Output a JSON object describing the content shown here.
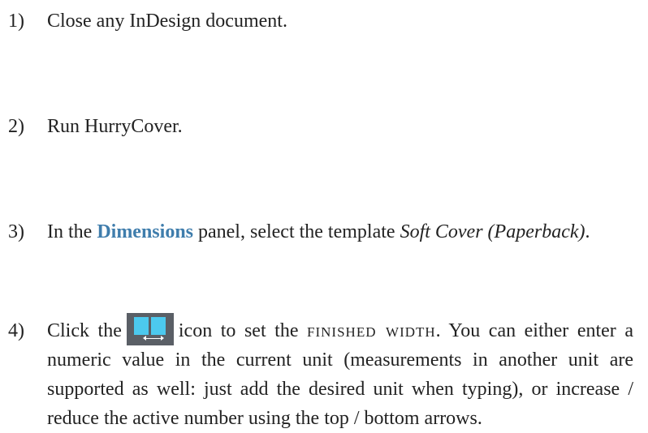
{
  "steps": [
    {
      "number": "1)",
      "text": "Close any InDesign document."
    },
    {
      "number": "2)",
      "text": "Run HurryCover."
    },
    {
      "number": "3)",
      "text_before": "In the ",
      "panel_name": "Dimensions",
      "text_middle": " panel, select the template ",
      "template_name": "Soft Cover (Paperback)",
      "text_end": "."
    },
    {
      "number": "4)",
      "text_before": "Click the",
      "icon": "finished-width-icon",
      "text_after_icon": "icon to set the ",
      "term": "Finished Width",
      "text_rest": ". You can either enter a numeric value in the current unit (measurements in another unit are supported as well: just add the desired unit when typing), or increase / reduce the active number using the top / bottom arrows."
    }
  ],
  "colors": {
    "accent": "#3f7dac",
    "icon_background": "#5a5f66",
    "icon_panes": "#4cc9ee"
  }
}
